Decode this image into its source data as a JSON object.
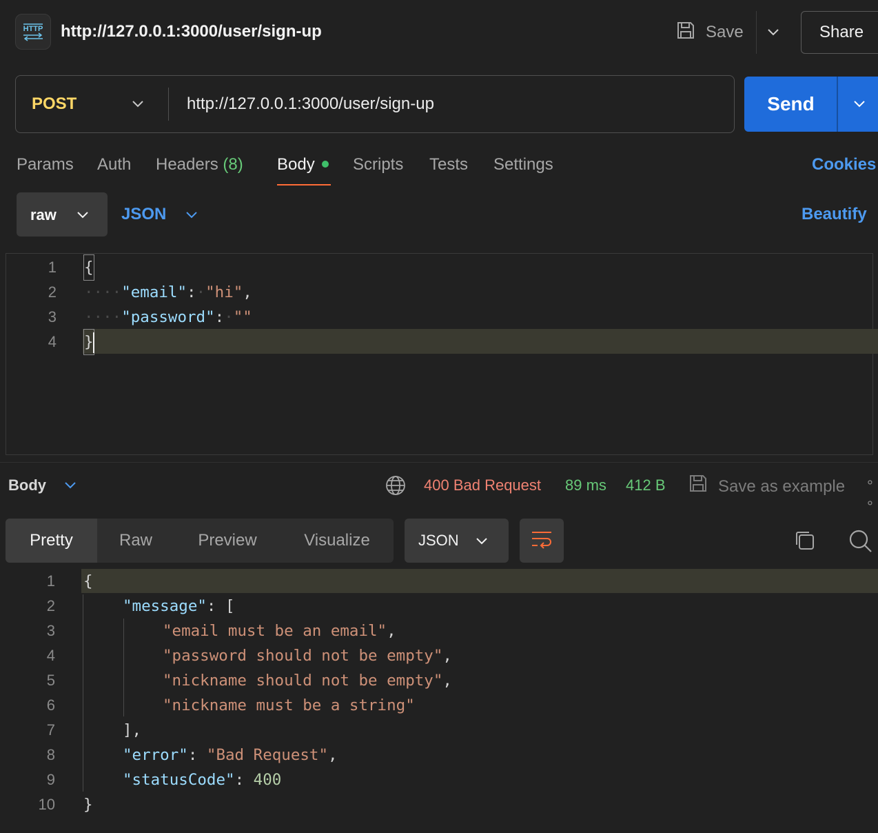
{
  "header": {
    "tab_title": "http://127.0.0.1:3000/user/sign-up",
    "save_label": "Save",
    "share_label": "Share",
    "icon": "http-icon"
  },
  "request": {
    "method": "POST",
    "url": "http://127.0.0.1:3000/user/sign-up",
    "send_label": "Send"
  },
  "tabs": {
    "params": "Params",
    "auth": "Auth",
    "headers": "Headers",
    "headers_count": "(8)",
    "body": "Body",
    "scripts": "Scripts",
    "tests": "Tests",
    "settings": "Settings",
    "active": "Body"
  },
  "cookies_label": "Cookies",
  "body_mode": {
    "mode": "raw",
    "language": "JSON",
    "beautify_label": "Beautify"
  },
  "request_body": {
    "line_numbers": [
      "1",
      "2",
      "3",
      "4"
    ],
    "open_brace": "{",
    "close_brace": "}",
    "l2_key": "\"email\"",
    "l2_value": "\"hi\"",
    "l3_key": "\"password\"",
    "l3_value": "\"\""
  },
  "response": {
    "section_label": "Body",
    "status": "400 Bad Request",
    "time": "89 ms",
    "size": "412 B",
    "save_example_label": "Save as example",
    "more": "°°",
    "views": [
      "Pretty",
      "Raw",
      "Preview",
      "Visualize"
    ],
    "active_view": "Pretty",
    "format": "JSON"
  },
  "response_body": {
    "line_numbers": [
      "1",
      "2",
      "3",
      "4",
      "5",
      "6",
      "7",
      "8",
      "9",
      "10"
    ],
    "open_brace": "{",
    "close_brace": "}",
    "message_key": "\"message\"",
    "open_bracket": "[",
    "close_bracket": "],",
    "msg1": "\"email must be an email\"",
    "msg2": "\"password should not be empty\"",
    "msg3": "\"nickname should not be empty\"",
    "msg4": "\"nickname must be a string\"",
    "error_key": "\"error\"",
    "error_value": "\"Bad Request\"",
    "status_key": "\"statusCode\"",
    "status_value": "400"
  },
  "colors": {
    "background": "#212121",
    "send_button": "#1f6cdb",
    "method": "#ffd766",
    "link_blue": "#4d9af0",
    "tab_accent": "#ff6c37",
    "success_green": "#67c978",
    "error_red": "#f08272",
    "json_key": "#9cdcfe",
    "json_string": "#ce9178",
    "json_number": "#b5cea8"
  }
}
